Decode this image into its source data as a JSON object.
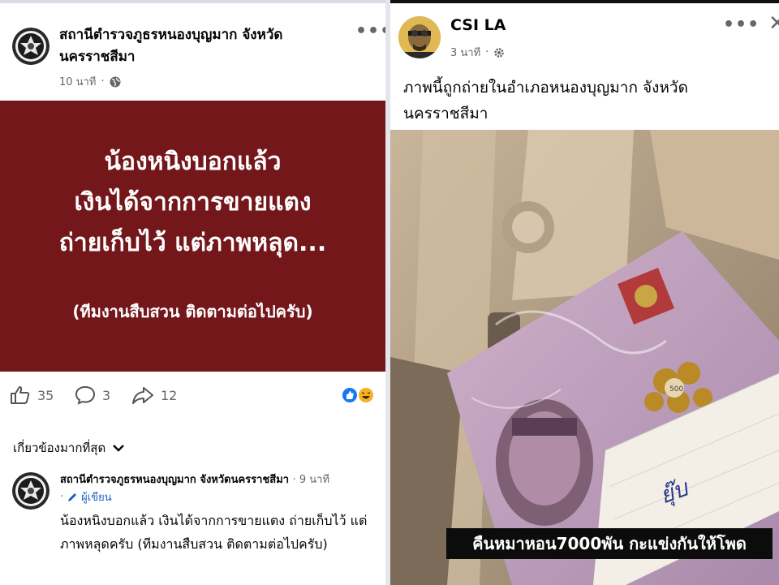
{
  "left_post": {
    "page_name_line1": "สถานีตำรวจภูธรหนองบุญมาก จังหวัด",
    "page_name_line2": "นครราชสีมา",
    "time": "10 นาที",
    "privacy_icon": "globe-icon",
    "more_icon": "more-dots-icon",
    "card": {
      "line1": "น้องหนิงบอกแล้ว",
      "line2": "เงินได้จากการขายแตง",
      "line3": "ถ่ายเก็บไว้ แต่ภาพหลุด...",
      "subline": "(ทีมงานสืบสวน ติดตามต่อไปครับ)",
      "bg_color": "#74171b"
    },
    "likes": "35",
    "comments": "3",
    "shares": "12",
    "reaction_icons": [
      "like-reaction-icon",
      "haha-reaction-icon"
    ]
  },
  "comments_filter": "เกี่ยวข้องมากที่สุด",
  "comment": {
    "author": "สถานีตำรวจภูธรหนองบุญมาก จังหวัดนครราชสีมา",
    "time": "· 9 นาที",
    "badge": "ผู้เขียน",
    "text": "น้องหนิงบอกแล้ว เงินได้จากการขายแตง ถ่ายเก็บไว้ แต่ภาพหลุดครับ (ทีมงานสืบสวน ติดตามต่อไปครับ)"
  },
  "right_post": {
    "page_name": "CSI LA",
    "time": "3 นาที",
    "privacy_icon": "settings-gear-icon",
    "more_icon": "more-dots-icon",
    "close_icon": "close-icon",
    "caption_line1": "ภาพนี้ถูกถ่ายในอำเภอหนองบุญมาก จังหวัด",
    "caption_line2": "นครราชสีมา",
    "photo_caption": "คืนหมาหอน7000พัน กะแข่งกันให้โพด",
    "banknote_denomination": "500",
    "handwritten_note": "ยุ๊บ"
  },
  "colors": {
    "accent_blue": "#1877f2",
    "meta_gray": "#65676b",
    "card_red": "#74171b"
  }
}
